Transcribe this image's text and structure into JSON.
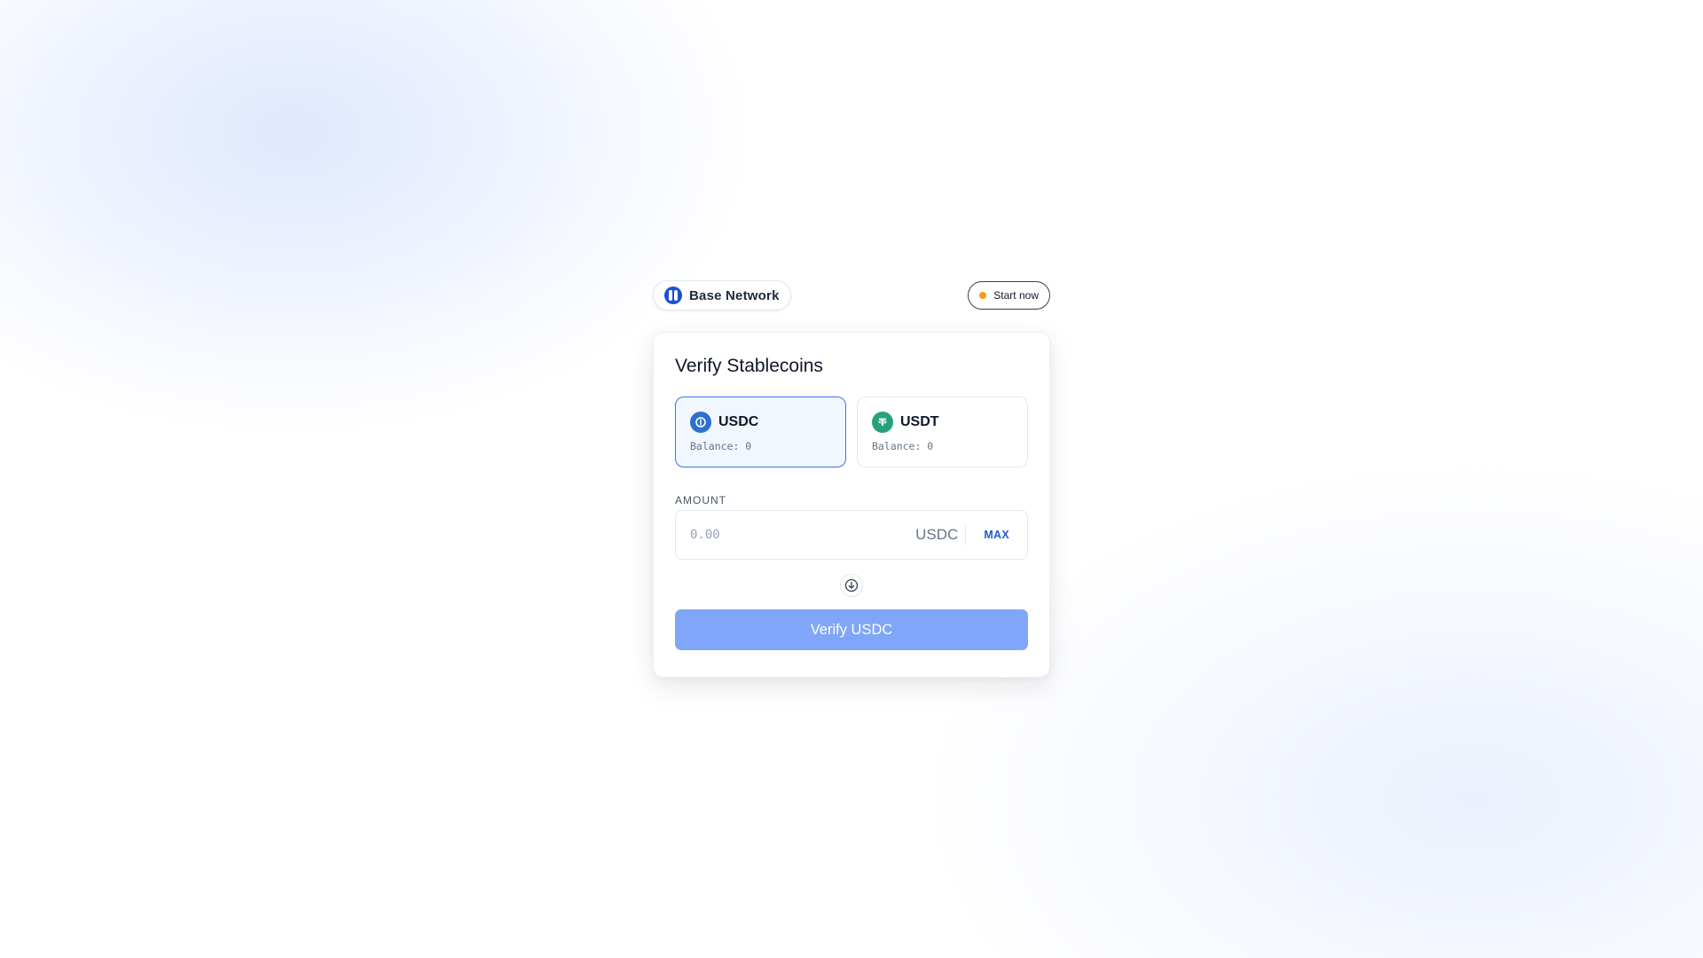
{
  "header": {
    "network_label": "Base Network",
    "network_icon": "base-network-icon",
    "start_label": "Start now",
    "status_color": "#f59e0b"
  },
  "card": {
    "title": "Verify Stablecoins",
    "tokens": [
      {
        "symbol": "USDC",
        "balance": "Balance: 0",
        "icon": "usdc-icon",
        "color": "#2f6fd1",
        "selected": true
      },
      {
        "symbol": "USDT",
        "balance": "Balance: 0",
        "icon": "usdt-icon",
        "color": "#26a17b",
        "selected": false
      }
    ],
    "amount": {
      "label": "AMOUNT",
      "placeholder": "0.00",
      "value": "",
      "unit": "USDC",
      "max_label": "MAX"
    },
    "swap_icon": "arrow-down-circle-icon",
    "submit_label": "Verify USDC",
    "accent": "#1d5bd8",
    "submit_color": "#7fa6f8"
  }
}
